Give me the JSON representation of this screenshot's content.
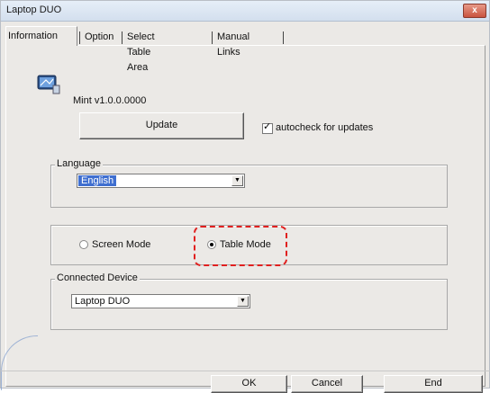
{
  "window": {
    "title": "Laptop DUO",
    "close_glyph": "x"
  },
  "tabs": [
    {
      "label": "Information",
      "active": true
    },
    {
      "label": "Option",
      "active": false
    },
    {
      "label": "Select Table Area",
      "active": false
    },
    {
      "label": "Manual Links",
      "active": false
    }
  ],
  "info": {
    "app_icon": "app-monitor-icon",
    "version": "Mint v1.0.0.0000",
    "update_label": "Update",
    "autocheck_label": "autocheck for updates",
    "autocheck_checked": true
  },
  "language": {
    "group_label": "Language",
    "selected": "English"
  },
  "mode": {
    "screen_label": "Screen Mode",
    "table_label": "Table Mode",
    "selected": "Table Mode"
  },
  "device": {
    "group_label": "Connected Device",
    "selected": "Laptop DUO"
  },
  "buttons": {
    "ok": "OK",
    "cancel": "Cancel",
    "end": "End"
  },
  "colors": {
    "highlight": "#e0201f",
    "selection": "#3f6fd0"
  }
}
